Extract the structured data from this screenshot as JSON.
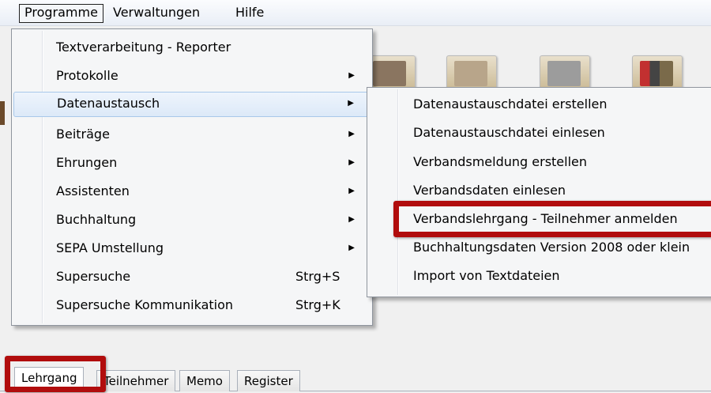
{
  "menubar": {
    "items": [
      "Programme",
      "Verwaltungen",
      "Hilfe"
    ]
  },
  "programme_menu": {
    "items": [
      {
        "label": "Textverarbeitung - Reporter",
        "submenu": false,
        "shortcut": ""
      },
      {
        "label": "Protokolle",
        "submenu": true,
        "shortcut": ""
      },
      {
        "label": "Datenaustausch",
        "submenu": true,
        "shortcut": ""
      },
      {
        "label": "Beiträge",
        "submenu": true,
        "shortcut": ""
      },
      {
        "label": "Ehrungen",
        "submenu": true,
        "shortcut": ""
      },
      {
        "label": "Assistenten",
        "submenu": true,
        "shortcut": ""
      },
      {
        "label": "Buchhaltung",
        "submenu": true,
        "shortcut": ""
      },
      {
        "label": "SEPA Umstellung",
        "submenu": true,
        "shortcut": ""
      },
      {
        "label": "Supersuche",
        "submenu": false,
        "shortcut": "Strg+S"
      },
      {
        "label": "Supersuche Kommunikation",
        "submenu": false,
        "shortcut": "Strg+K"
      }
    ],
    "highlighted": "Datenaustausch"
  },
  "datenaustausch_submenu": {
    "items": [
      "Datenaustauschdatei erstellen",
      "Datenaustauschdatei einlesen",
      "Verbandsmeldung erstellen",
      "Verbandsdaten einlesen",
      "Verbandslehrgang - Teilnehmer anmelden",
      "Buchhaltungsdaten Version 2008 oder klein",
      "Import von Textdateien"
    ],
    "emphasized": "Verbandslehrgang - Teilnehmer anmelden"
  },
  "tabs": {
    "items": [
      "Lehrgang",
      "Teilnehmer",
      "Memo",
      "Register"
    ],
    "active": "Lehrgang"
  },
  "icons": {
    "submenu_arrow": "▶"
  },
  "colors": {
    "highlight_box": "#b10d0d",
    "menu_hover": "#dce9f8"
  }
}
